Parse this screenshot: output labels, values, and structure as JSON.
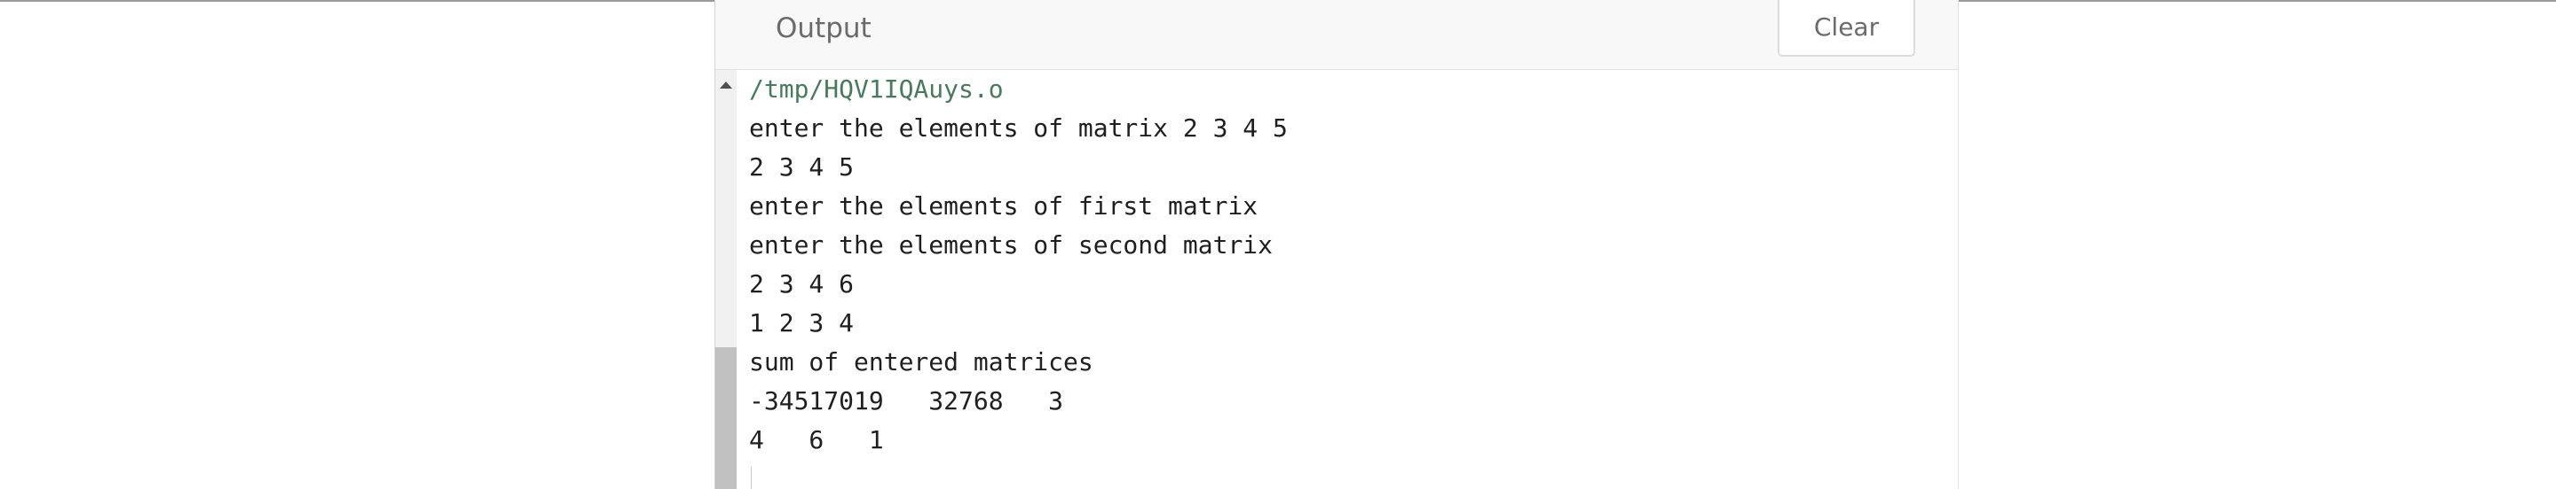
{
  "header": {
    "title": "Output",
    "clear_label": "Clear"
  },
  "output_lines": [
    "/tmp/HQV1IQAuys.o",
    "enter the elements of matrix 2 3 4 5",
    "2 3 4 5",
    "enter the elements of first matrix",
    "enter the elements of second matrix",
    "2 3 4 6",
    "1 2 3 4",
    "sum of entered matrices",
    "-34517019   32768   3",
    "4   6   1"
  ]
}
